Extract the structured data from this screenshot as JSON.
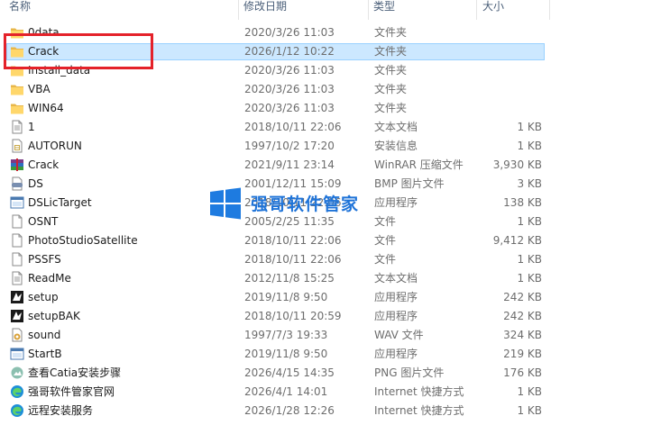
{
  "columns": {
    "name": "名称",
    "date": "修改日期",
    "type": "类型",
    "size": "大小"
  },
  "rows": [
    {
      "name": "0data",
      "date": "2020/3/26 11:03",
      "type": "文件夹",
      "size": "",
      "icon": "folder-icon"
    },
    {
      "name": "Crack",
      "date": "2026/1/12 10:22",
      "type": "文件夹",
      "size": "",
      "icon": "folder-icon",
      "selected": true
    },
    {
      "name": "Install_data",
      "date": "2020/3/26 11:03",
      "type": "文件夹",
      "size": "",
      "icon": "folder-icon"
    },
    {
      "name": "VBA",
      "date": "2020/3/26 11:03",
      "type": "文件夹",
      "size": "",
      "icon": "folder-icon"
    },
    {
      "name": "WIN64",
      "date": "2020/3/26 11:03",
      "type": "文件夹",
      "size": "",
      "icon": "folder-icon"
    },
    {
      "name": "1",
      "date": "2018/10/11 22:06",
      "type": "文本文档",
      "size": "1 KB",
      "icon": "text-file-icon"
    },
    {
      "name": "AUTORUN",
      "date": "1997/10/2 17:20",
      "type": "安装信息",
      "size": "1 KB",
      "icon": "setup-info-icon"
    },
    {
      "name": "Crack",
      "date": "2021/9/11 23:14",
      "type": "WinRAR 压缩文件",
      "size": "3,930 KB",
      "icon": "winrar-archive-icon"
    },
    {
      "name": "DS",
      "date": "2001/12/11 15:09",
      "type": "BMP 图片文件",
      "size": "3 KB",
      "icon": "bmp-image-icon"
    },
    {
      "name": "DSLicTarget",
      "date": "2018/10/11 22:06",
      "type": "应用程序",
      "size": "138 KB",
      "icon": "application-icon"
    },
    {
      "name": "OSNT",
      "date": "2005/2/25 11:35",
      "type": "文件",
      "size": "1 KB",
      "icon": "blank-file-icon"
    },
    {
      "name": "PhotoStudioSatellite",
      "date": "2018/10/11 22:06",
      "type": "文件",
      "size": "9,412 KB",
      "icon": "blank-file-icon"
    },
    {
      "name": "PSSFS",
      "date": "2018/10/11 22:06",
      "type": "文件",
      "size": "1 KB",
      "icon": "blank-file-icon"
    },
    {
      "name": "ReadMe",
      "date": "2012/11/8 15:25",
      "type": "文本文档",
      "size": "1 KB",
      "icon": "text-file-icon"
    },
    {
      "name": "setup",
      "date": "2019/11/8 9:50",
      "type": "应用程序",
      "size": "242 KB",
      "icon": "catia-setup-icon"
    },
    {
      "name": "setupBAK",
      "date": "2018/10/11 20:59",
      "type": "应用程序",
      "size": "242 KB",
      "icon": "catia-setup-icon"
    },
    {
      "name": "sound",
      "date": "1997/7/3 19:33",
      "type": "WAV 文件",
      "size": "324 KB",
      "icon": "audio-file-icon"
    },
    {
      "name": "StartB",
      "date": "2019/11/8 9:50",
      "type": "应用程序",
      "size": "219 KB",
      "icon": "application-icon"
    },
    {
      "name": "查看Catia安装步骤",
      "date": "2026/4/15 14:35",
      "type": "PNG 图片文件",
      "size": "176 KB",
      "icon": "png-image-icon"
    },
    {
      "name": "强哥软件管家官网",
      "date": "2026/4/1 14:01",
      "type": "Internet 快捷方式",
      "size": "1 KB",
      "icon": "edge-shortcut-icon"
    },
    {
      "name": "远程安装服务",
      "date": "2026/1/28 12:26",
      "type": "Internet 快捷方式",
      "size": "1 KB",
      "icon": "edge-shortcut-icon"
    }
  ],
  "watermark": {
    "text": "强哥软件管家"
  },
  "colors": {
    "selection": "#cce8ff",
    "highlight_box": "#e4222a",
    "watermark": "#1e73d8"
  }
}
